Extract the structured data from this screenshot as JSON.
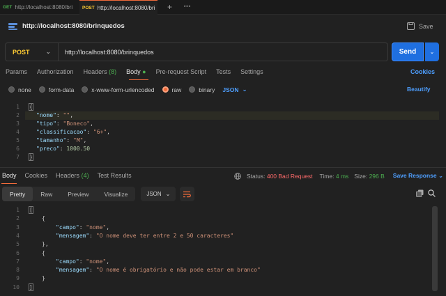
{
  "tabs": [
    {
      "method": "GET",
      "title": "http://localhost:8080/bri"
    },
    {
      "method": "POST",
      "title": "http://localhost:8080/bri"
    }
  ],
  "tab_controls": {
    "add": "+",
    "more": "∘∘∘"
  },
  "request": {
    "title": "http://localhost:8080/brinquedos",
    "save_label": "Save",
    "method": "POST",
    "url": "http://localhost:8080/brinquedos",
    "send_label": "Send"
  },
  "request_tabs": {
    "params": "Params",
    "authorization": "Authorization",
    "headers": "Headers",
    "headers_count": "(8)",
    "body": "Body",
    "prerequest": "Pre-request Script",
    "tests": "Tests",
    "settings": "Settings",
    "cookies": "Cookies"
  },
  "body_options": {
    "none": "none",
    "form_data": "form-data",
    "urlencoded": "x-www-form-urlencoded",
    "raw": "raw",
    "binary": "binary",
    "format": "JSON",
    "beautify": "Beautify"
  },
  "request_body": {
    "line_numbers": [
      "1",
      "2",
      "3",
      "4",
      "5",
      "6",
      "7"
    ],
    "open": "{",
    "close": "}",
    "fields": [
      {
        "key": "\"nome\"",
        "value": "\"\"",
        "type": "string",
        "comma": ","
      },
      {
        "key": "\"tipo\"",
        "value": "\"Boneco\"",
        "type": "string",
        "comma": ","
      },
      {
        "key": "\"classificacao\"",
        "value": "\"6+\"",
        "type": "string",
        "comma": ","
      },
      {
        "key": "\"tamanho\"",
        "value": "\"M\"",
        "type": "string",
        "comma": ","
      },
      {
        "key": "\"preco\"",
        "value": "1000.50",
        "type": "number",
        "comma": ""
      }
    ]
  },
  "response": {
    "tabs": {
      "body": "Body",
      "cookies": "Cookies",
      "headers": "Headers",
      "headers_count": "(4)",
      "test_results": "Test Results"
    },
    "status_label": "Status:",
    "status_value": "400 Bad Request",
    "time_label": "Time:",
    "time_value": "4 ms",
    "size_label": "Size:",
    "size_value": "296 B",
    "save_response": "Save Response",
    "views": {
      "pretty": "Pretty",
      "raw": "Raw",
      "preview": "Preview",
      "visualize": "Visualize"
    },
    "format": "JSON",
    "line_numbers": [
      "1",
      "2",
      "3",
      "4",
      "5",
      "6",
      "7",
      "8",
      "9",
      "10"
    ],
    "lines": {
      "l1": "[",
      "l2": "{",
      "l3_key": "\"campo\"",
      "l3_val": "\"nome\"",
      "l4_key": "\"mensagem\"",
      "l4_val": "\"O nome deve ter entre 2 e 50 caracteres\"",
      "l5": "},",
      "l6": "{",
      "l7_key": "\"campo\"",
      "l7_val": "\"nome\"",
      "l8_key": "\"mensagem\"",
      "l8_val": "\"O nome é obrigatório e não pode estar em branco\"",
      "l9": "}",
      "l10": "]"
    }
  }
}
